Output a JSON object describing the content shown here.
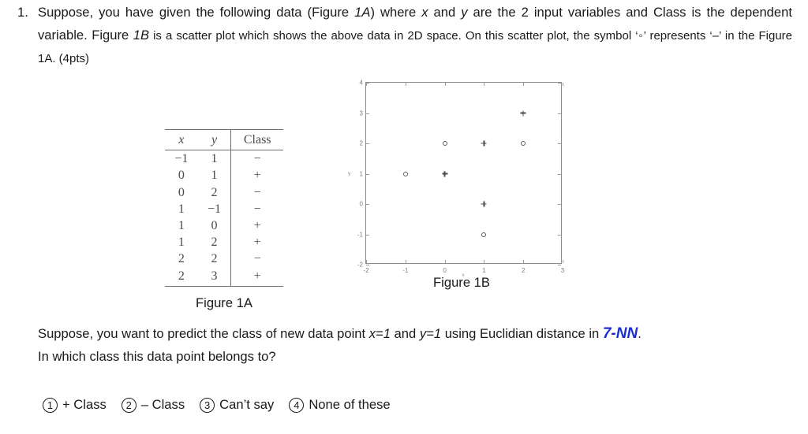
{
  "question": {
    "number": "1.",
    "line_parts": [
      "Suppose, you have given the following data (Figure ",
      "1A",
      ") where ",
      "x",
      " and ",
      "y",
      " are the 2 input variables and Class is the dependent variable. Figure ",
      "1B",
      " is a scatter plot which shows the above data in 2D space. On this scatter plot, the symbol ‘◦’ represents ‘–’ in the Figure 1A. (4pts)"
    ],
    "full_text": "Suppose, you have given the following data (Figure 1A) where x and y are the 2 input variables and Class is the dependent variable. Figure 1B is a scatter plot which shows the above data in 2D space. On this scatter plot, the symbol ‘◦’ represents ‘–’ in the Figure 1A. (4pts)"
  },
  "figure_1a": {
    "caption": "Figure 1A",
    "columns": [
      "x",
      "y",
      "Class"
    ],
    "rows": [
      {
        "x": "−1",
        "y": "1",
        "class": "−"
      },
      {
        "x": "0",
        "y": "1",
        "class": "+"
      },
      {
        "x": "0",
        "y": "2",
        "class": "−"
      },
      {
        "x": "1",
        "y": "−1",
        "class": "−"
      },
      {
        "x": "1",
        "y": "0",
        "class": "+"
      },
      {
        "x": "1",
        "y": "2",
        "class": "+"
      },
      {
        "x": "2",
        "y": "2",
        "class": "−"
      },
      {
        "x": "2",
        "y": "3",
        "class": "+"
      }
    ]
  },
  "figure_1b": {
    "caption": "Figure 1B",
    "xlabel": "x",
    "ylabel": "y",
    "x_ticks": [
      "-2",
      "-1",
      "0",
      "1",
      "2",
      "3"
    ],
    "y_ticks": [
      "-2",
      "-1",
      "0",
      "1",
      "2",
      "3",
      "4"
    ]
  },
  "chart_data": {
    "type": "scatter",
    "title": "Figure 1B",
    "xlabel": "x",
    "ylabel": "y",
    "xlim": [
      -2,
      3
    ],
    "ylim": [
      -2,
      4
    ],
    "xticks": [
      -2,
      -1,
      0,
      1,
      2,
      3
    ],
    "yticks": [
      -2,
      -1,
      0,
      1,
      2,
      3,
      4
    ],
    "grid": false,
    "legend": null,
    "series": [
      {
        "name": "− (minus class)",
        "marker": "circle",
        "points": [
          {
            "x": -1,
            "y": 1
          },
          {
            "x": 0,
            "y": 2
          },
          {
            "x": 1,
            "y": -1
          },
          {
            "x": 2,
            "y": 2
          }
        ]
      },
      {
        "name": "+ (plus class)",
        "marker": "plus",
        "points": [
          {
            "x": 0,
            "y": 1
          },
          {
            "x": 1,
            "y": 0
          },
          {
            "x": 1,
            "y": 2
          },
          {
            "x": 2,
            "y": 3
          }
        ]
      }
    ]
  },
  "prompt": {
    "lead": "Suppose, you want to predict the class of new data point ",
    "x_eq": "x=1",
    "and": " and ",
    "y_eq": "y=1",
    "mid": " using Euclidian distance in ",
    "highlight": "7-NN",
    "tail": ".",
    "second_line": "In which class this data point belongs to?"
  },
  "options": [
    {
      "num": "1",
      "label": "+ Class"
    },
    {
      "num": "2",
      "label": "– Class"
    },
    {
      "num": "3",
      "label": "Can’t say"
    },
    {
      "num": "4",
      "label": "None of these"
    }
  ],
  "colors": {
    "highlight_blue": "#1a2ed6",
    "text": "#1a1a1a",
    "plot_line": "#8c8c8c",
    "table_rule": "#6d6d6d"
  }
}
